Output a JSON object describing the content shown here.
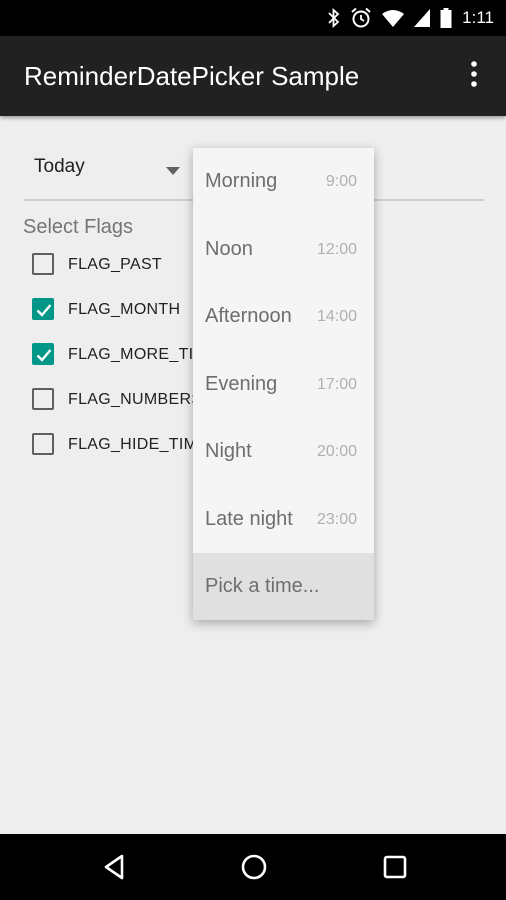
{
  "status_bar": {
    "time": "1:11",
    "icons": [
      "bluetooth-icon",
      "alarm-icon",
      "wifi-icon",
      "cell-signal-icon",
      "battery-icon"
    ]
  },
  "app_bar": {
    "title": "ReminderDatePicker Sample",
    "menu_icon": "overflow-menu-icon"
  },
  "date_spinner": {
    "value": "Today"
  },
  "flags": {
    "title": "Select Flags",
    "items": [
      {
        "label": "FLAG_PAST",
        "checked": false
      },
      {
        "label": "FLAG_MONTH",
        "checked": true
      },
      {
        "label": "FLAG_MORE_TIM",
        "checked": true
      },
      {
        "label": "FLAG_NUMBERS",
        "checked": false
      },
      {
        "label": "FLAG_HIDE_TIM",
        "checked": false
      }
    ]
  },
  "time_dropdown": {
    "items": [
      {
        "label": "Morning",
        "time": "9:00"
      },
      {
        "label": "Noon",
        "time": "12:00"
      },
      {
        "label": "Afternoon",
        "time": "14:00"
      },
      {
        "label": "Evening",
        "time": "17:00"
      },
      {
        "label": "Night",
        "time": "20:00"
      },
      {
        "label": "Late night",
        "time": "23:00"
      }
    ],
    "pick_label": "Pick a time..."
  },
  "nav_bar": {
    "icons": [
      "back-icon",
      "home-icon",
      "recents-icon"
    ]
  },
  "colors": {
    "accent": "#009688",
    "app_bar": "#212121",
    "background": "#eeeeee"
  }
}
